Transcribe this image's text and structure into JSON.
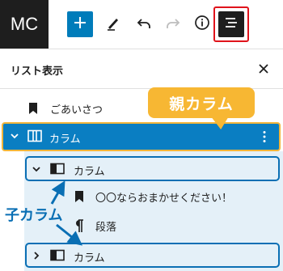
{
  "toolbar": {
    "logo": "MC",
    "add_icon": "plus-icon",
    "tools_icon": "pencil-icon",
    "undo_icon": "undo-icon",
    "redo_icon": "redo-icon",
    "info_icon": "info-icon",
    "list_view_icon": "list-view-icon",
    "accent": "#007cba",
    "highlight": "#e0131b"
  },
  "panel": {
    "title": "リスト表示",
    "close_icon": "close-icon"
  },
  "tree": {
    "items": [
      {
        "label": "ごあいさつ",
        "icon": "bookmark-icon"
      },
      {
        "label": "カラム",
        "icon": "columns-icon",
        "expanded": true,
        "selected": true
      },
      {
        "label": "カラム",
        "icon": "column-icon",
        "expanded": true
      },
      {
        "label": "〇〇ならおまかせください！",
        "icon": "bookmark-icon"
      },
      {
        "label": "段落",
        "icon": "paragraph-icon"
      },
      {
        "label": "カラム",
        "icon": "column-icon",
        "expanded": false
      }
    ]
  },
  "annotations": {
    "parent_label": "親カラム",
    "child_label": "子カラム",
    "parent_color": "#f7b733",
    "child_color": "#0a6fb4"
  }
}
